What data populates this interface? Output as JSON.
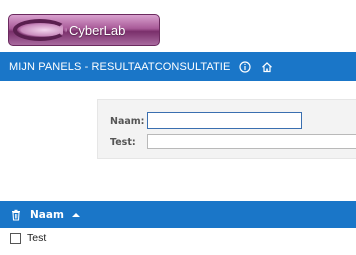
{
  "logo": {
    "text": "CyberLab"
  },
  "header": {
    "title": "MIJN PANELS - RESULTAATCONSULTATIE",
    "info_icon": "info-icon",
    "home_icon": "home-icon"
  },
  "form": {
    "fields": [
      {
        "label": "Naam:",
        "value": ""
      },
      {
        "label": "Test:",
        "value": ""
      }
    ]
  },
  "table": {
    "columns": [
      {
        "label": "Naam",
        "sort": "ascending"
      }
    ],
    "rows": [
      {
        "checked": false,
        "naam": "Test"
      }
    ]
  },
  "colors": {
    "accent": "#1a76c8",
    "logo": "#a85a98"
  }
}
